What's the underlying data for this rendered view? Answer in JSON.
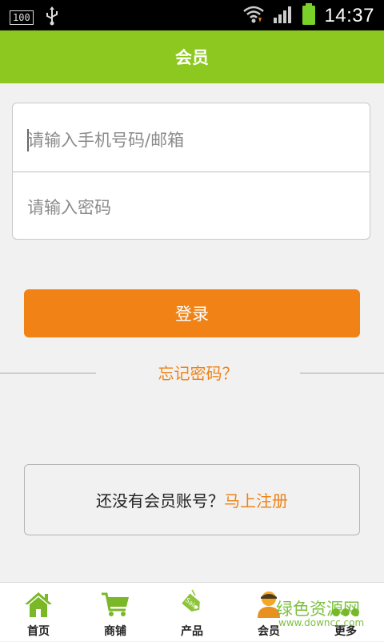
{
  "status_bar": {
    "battery_badge": "100",
    "time": "14:37"
  },
  "header": {
    "title": "会员"
  },
  "login": {
    "phone_placeholder": "请输入手机号码/邮箱",
    "password_placeholder": "请输入密码",
    "login_label": "登录",
    "forgot_label": "忘记密码？"
  },
  "register": {
    "prompt": "还没有会员账号？",
    "link": "马上注册"
  },
  "bottom_nav": {
    "items": [
      {
        "label": "首页",
        "icon": "home-icon"
      },
      {
        "label": "商铺",
        "icon": "cart-icon"
      },
      {
        "label": "产品",
        "icon": "sale-tag-icon"
      },
      {
        "label": "会员",
        "icon": "user-icon"
      },
      {
        "label": "更多",
        "icon": "more-icon"
      }
    ]
  },
  "watermark": {
    "text": "绿色资源网",
    "sub": "www.downcc.com"
  },
  "colors": {
    "accent_green": "#8cc820",
    "accent_orange": "#f08216",
    "icon_green": "#7ab828"
  }
}
